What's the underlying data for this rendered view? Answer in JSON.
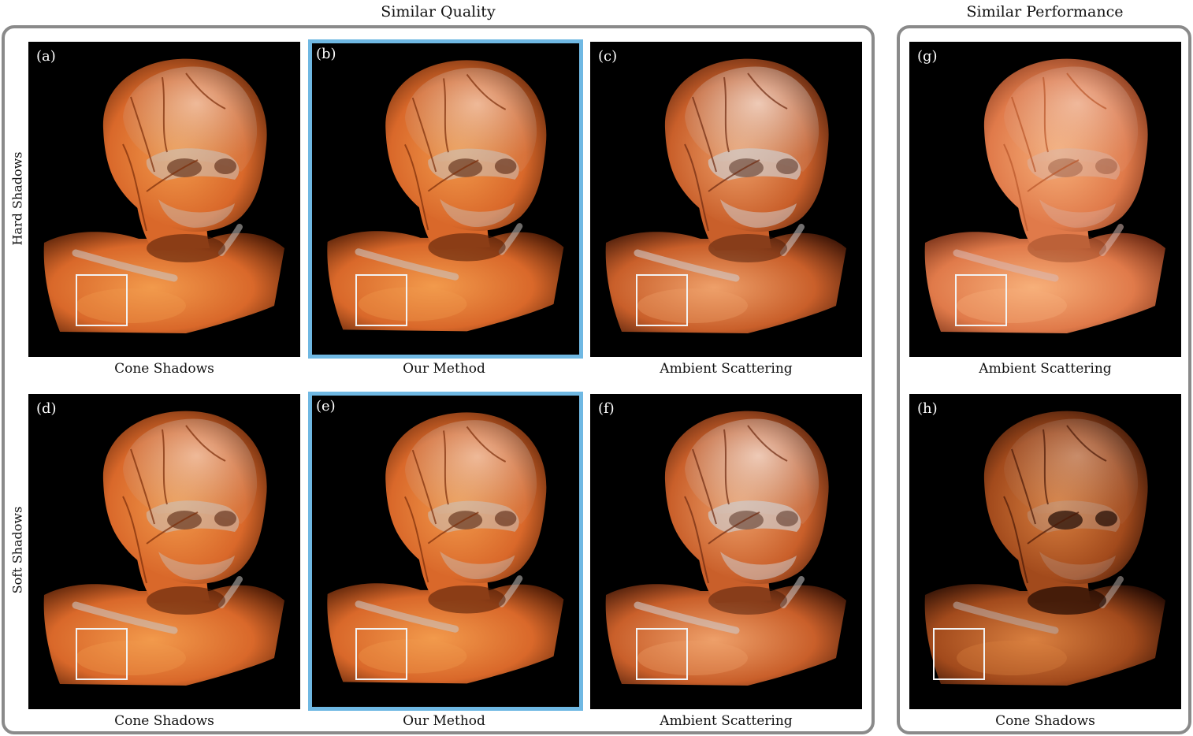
{
  "groups": {
    "quality": {
      "title": "Similar Quality"
    },
    "performance": {
      "title": "Similar Performance"
    }
  },
  "rows": {
    "hard": "Hard Shadows",
    "soft": "Soft Shadows"
  },
  "panels": {
    "a": {
      "letter": "(a)",
      "caption": "Cone Shadows"
    },
    "b": {
      "letter": "(b)",
      "caption": "Our Method"
    },
    "c": {
      "letter": "(c)",
      "caption": "Ambient Scattering"
    },
    "d": {
      "letter": "(d)",
      "caption": "Cone Shadows"
    },
    "e": {
      "letter": "(e)",
      "caption": "Our Method"
    },
    "f": {
      "letter": "(f)",
      "caption": "Ambient Scattering"
    },
    "g": {
      "letter": "(g)",
      "caption": "Ambient Scattering"
    },
    "h": {
      "letter": "(h)",
      "caption": "Cone Shadows"
    }
  },
  "colors": {
    "highlight_border": "#6fb8e3",
    "group_frame": "#8a8a8a",
    "tissue": "#d9682a",
    "bone": "#c9c3c0"
  }
}
